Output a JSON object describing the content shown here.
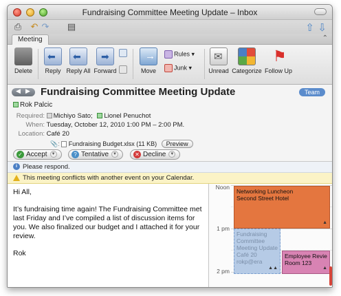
{
  "window": {
    "title": "Fundraising Committee Meeting Update – Inbox"
  },
  "ribbon": {
    "tab": "Meeting",
    "buttons": {
      "delete": "Delete",
      "reply": "Reply",
      "reply_all": "Reply All",
      "forward": "Forward",
      "move": "Move",
      "rules": "Rules",
      "junk": "Junk",
      "unread": "Unread",
      "categorize": "Categorize",
      "follow_up": "Follow Up"
    }
  },
  "message": {
    "subject": "Fundraising Committee Meeting Update",
    "category_badge": "Team",
    "sender": "Rok Palcic",
    "required_label": "Required:",
    "required": [
      "Michiyo Sato;",
      "Lionel Penuchot"
    ],
    "when_label": "When:",
    "when": "Tuesday, October 12, 2010 1:00 PM – 2:00 PM.",
    "location_label": "Location:",
    "location": "Café 20",
    "attachment": "Fundraising Budget.xlsx (11 KB)",
    "preview_label": "Preview",
    "accept_label": "Accept",
    "tentative_label": "Tentative",
    "decline_label": "Decline"
  },
  "infobars": {
    "respond": "Please respond.",
    "conflict": "This meeting conflicts with another event on your Calendar."
  },
  "body": {
    "greeting": "Hi All,",
    "paragraph": "It’s fundraising time again! The Fundraising Committee met last Friday and I’ve compiled a list of discussion items for you. We also finalized our budget and I attached it for your review.",
    "signature": "Rok"
  },
  "calendar": {
    "times": [
      "Noon",
      "1 pm",
      "2 pm"
    ],
    "events": {
      "lunch": {
        "title": "Networking Luncheon",
        "location": "Second Street Hotel",
        "color": "#e4763f"
      },
      "fundraising": {
        "title": "Fundraising Committee Meeting Update",
        "location": "Café 20",
        "organizer": "rokp@era",
        "color": "#b6cbe6"
      },
      "employee": {
        "title": "Employee Revie",
        "location": "Room 123",
        "color": "#d883b3"
      }
    }
  },
  "colors": {
    "accent": "#5b8ccc",
    "conflict_bg": "#fbf3c6"
  }
}
